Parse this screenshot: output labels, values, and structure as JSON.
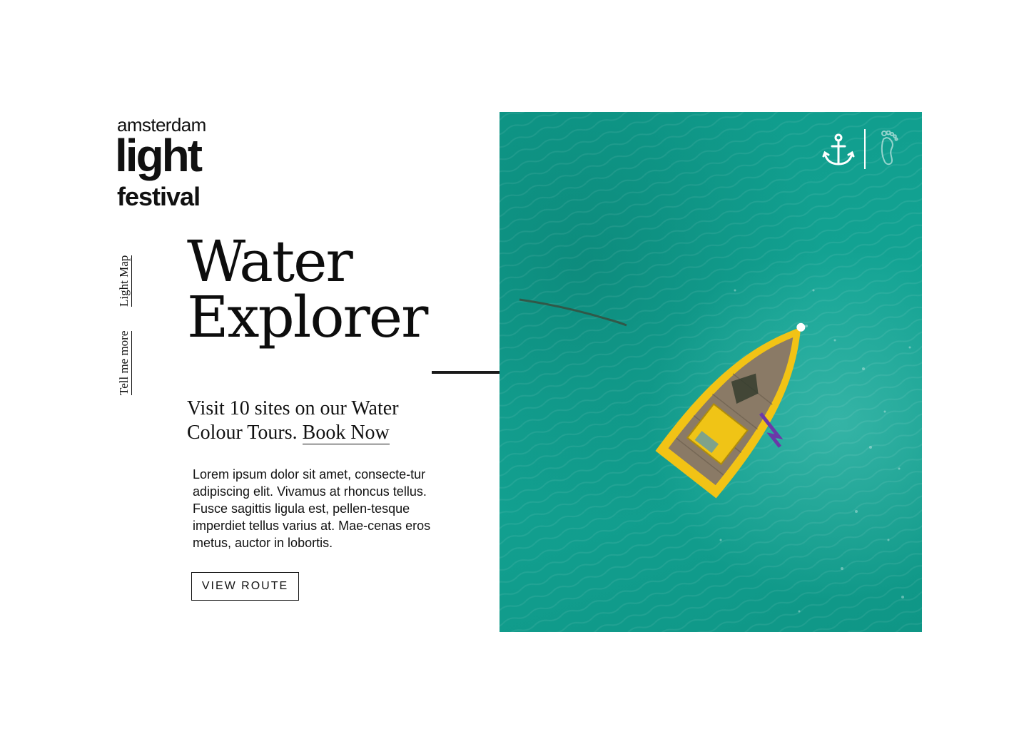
{
  "logo": {
    "line1": "amsterdam",
    "line2": "light",
    "line3": "festival"
  },
  "side_nav": {
    "light_map": "Light Map",
    "tell_me_more": "Tell me more"
  },
  "headline": {
    "line1": "Water",
    "line2": "Explorer"
  },
  "subhead": {
    "text": "Visit 10 sites on our Water Colour Tours. ",
    "link": "Book Now"
  },
  "body": "Lorem ipsum dolor sit amet, consecte-tur adipiscing elit. Vivamus at rhoncus tellus. Fusce sagittis ligula est, pellen-tesque imperdiet tellus varius at. Mae-cenas eros metus, auctor in lobortis.",
  "cta": {
    "label": "VIEW ROUTE"
  },
  "hero": {
    "icons": [
      "anchor-icon",
      "footprint-icon"
    ],
    "water_color": "#13a393",
    "boat_color": "#f2c315"
  }
}
